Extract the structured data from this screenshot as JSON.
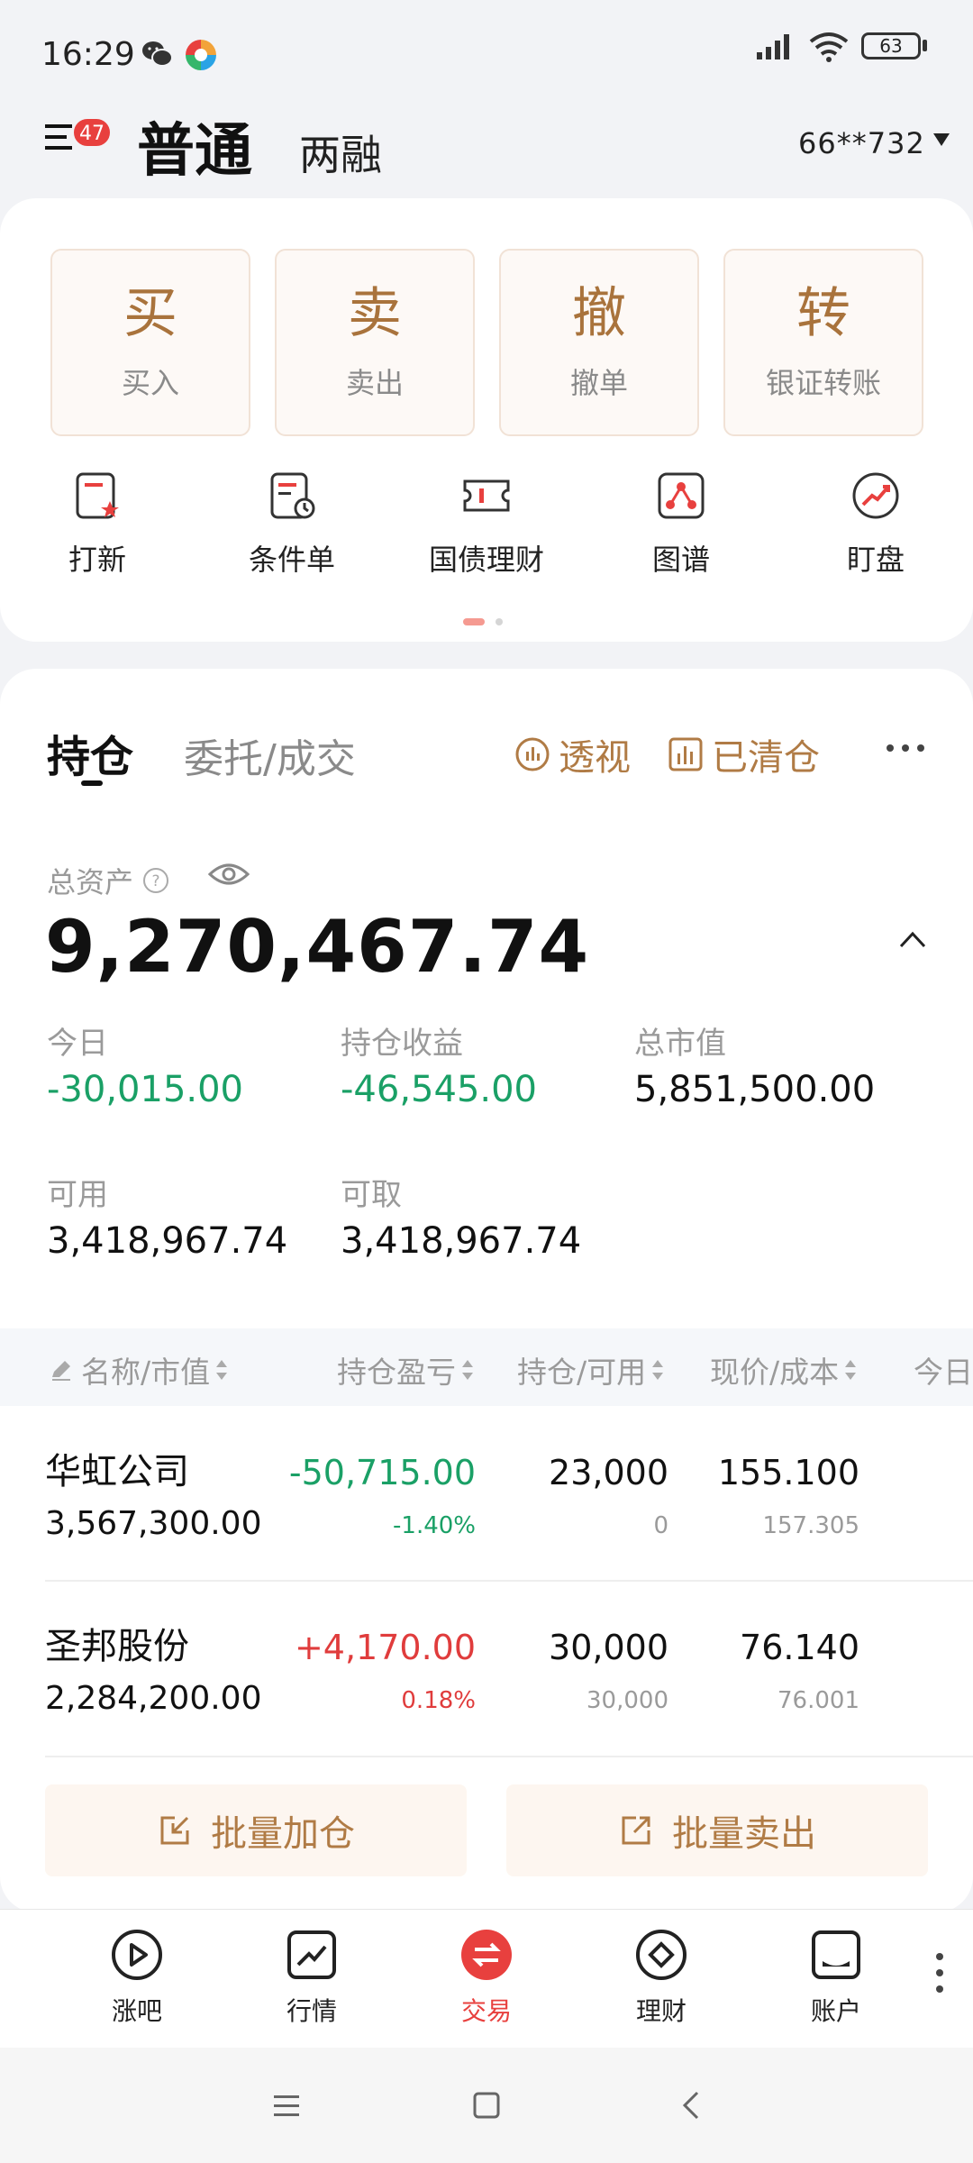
{
  "status": {
    "time": "16:29",
    "battery": "63"
  },
  "header": {
    "menu_badge": "47",
    "tab_normal": "普通",
    "tab_margin": "两融",
    "account": "66**732"
  },
  "actions": [
    {
      "big": "买",
      "small": "买入"
    },
    {
      "big": "卖",
      "small": "卖出"
    },
    {
      "big": "撤",
      "small": "撤单"
    },
    {
      "big": "转",
      "small": "银证转账"
    }
  ],
  "quick": [
    {
      "label": "打新",
      "icon": "ipo-icon"
    },
    {
      "label": "条件单",
      "icon": "conditional-order-icon"
    },
    {
      "label": "国债理财",
      "icon": "bond-ticket-icon"
    },
    {
      "label": "图谱",
      "icon": "graph-icon"
    },
    {
      "label": "盯盘",
      "icon": "watch-trend-icon"
    }
  ],
  "positions": {
    "tab_holding": "持仓",
    "tab_entrust": "委托/成交",
    "perspective": "透视",
    "cleared": "已清仓"
  },
  "summary": {
    "total_label": "总资产",
    "total_value": "9,270,467.74",
    "today_label": "今日",
    "today_value": "-30,015.00",
    "profit_label": "持仓收益",
    "profit_value": "-46,545.00",
    "market_label": "总市值",
    "market_value": "5,851,500.00",
    "available_label": "可用",
    "available_value": "3,418,967.74",
    "withdraw_label": "可取",
    "withdraw_value": "3,418,967.74"
  },
  "table": {
    "headers": [
      "名称/市值",
      "持仓盈亏",
      "持仓/可用",
      "现价/成本",
      "今日"
    ],
    "rows": [
      {
        "name": "华虹公司",
        "market_value": "3,567,300.00",
        "pnl": "-50,715.00",
        "pnl_pct": "-1.40%",
        "holding": "23,000",
        "available": "0",
        "price": "155.100",
        "cost": "157.305",
        "direction": "down"
      },
      {
        "name": "圣邦股份",
        "market_value": "2,284,200.00",
        "pnl": "+4,170.00",
        "pnl_pct": "0.18%",
        "holding": "30,000",
        "available": "30,000",
        "price": "76.140",
        "cost": "76.001",
        "direction": "up"
      }
    ]
  },
  "batch": {
    "add": "批量加仓",
    "sell": "批量卖出"
  },
  "nav": [
    {
      "label": "涨吧",
      "icon": "play-circle-icon"
    },
    {
      "label": "行情",
      "icon": "trend-chart-icon"
    },
    {
      "label": "交易",
      "icon": "exchange-icon",
      "active": true
    },
    {
      "label": "理财",
      "icon": "diamond-circle-icon"
    },
    {
      "label": "账户",
      "icon": "account-icon"
    }
  ],
  "colors": {
    "accent": "#b07b45",
    "up": "#e03c3c",
    "down": "#1aa066",
    "active_nav": "#e8403e"
  }
}
